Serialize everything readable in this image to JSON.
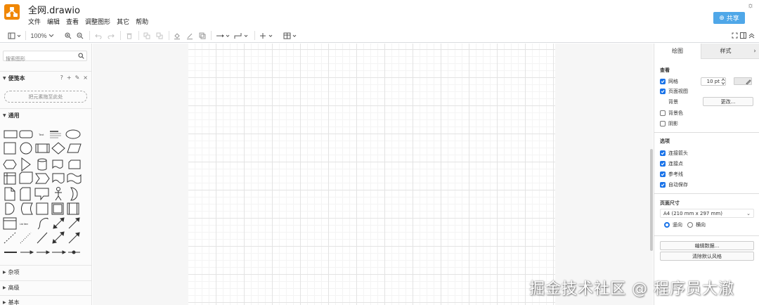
{
  "app": {
    "title": "全网.drawio",
    "menu": [
      "文件",
      "编辑",
      "查看",
      "调整图形",
      "其它",
      "帮助"
    ],
    "share_label": "共享",
    "accent_color": "#f08705",
    "share_color": "#4fa7e8"
  },
  "toolbar": {
    "zoom": "100%",
    "icons": [
      "format-panel-icon",
      "zoom-in-icon",
      "zoom-out-icon",
      "undo-icon",
      "redo-icon",
      "delete-icon",
      "to-front-icon",
      "to-back-icon",
      "fill-color-icon",
      "line-color-icon",
      "shadow-icon",
      "connection-icon",
      "waypoints-icon",
      "insert-icon",
      "table-icon",
      "fullscreen-icon",
      "format-toggle-icon",
      "collapse-icon"
    ]
  },
  "sidebar": {
    "search_placeholder": "搜索图形",
    "scratchpad_title": "便笺本",
    "scratchpad_drop": "把元素拖至此处",
    "general_title": "通用",
    "sections": [
      "杂项",
      "高级",
      "基本"
    ],
    "shape_text_label": "Text",
    "shape_textbox_label": "Heading",
    "shape_list_label": "List Item"
  },
  "format_panel": {
    "tabs": [
      "绘图",
      "样式"
    ],
    "view_title": "查看",
    "grid_label": "网格",
    "grid_checked": true,
    "grid_size": "10 pt",
    "page_view_label": "页面视图",
    "page_view_checked": true,
    "background_label": "背景",
    "change_button": "更改...",
    "bg_color_label": "背景色",
    "bg_color_checked": false,
    "shadow_label": "阴影",
    "shadow_checked": false,
    "options_title": "选项",
    "options": [
      {
        "label": "连接箭头",
        "checked": true
      },
      {
        "label": "连接点",
        "checked": true
      },
      {
        "label": "参考线",
        "checked": true
      },
      {
        "label": "自动保存",
        "checked": true
      }
    ],
    "page_size_title": "页面尺寸",
    "page_size_value": "A4 (210 mm x 297 mm)",
    "orientation_portrait": "竖向",
    "orientation_landscape": "横向",
    "orientation_selected": "竖向",
    "edit_data_button": "编辑数据...",
    "clear_style_button": "清除默认风格"
  },
  "watermark": "掘金技术社区 @ 程序员大澈"
}
